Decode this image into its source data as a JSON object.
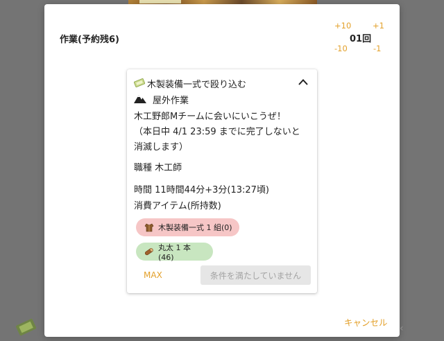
{
  "modal": {
    "title": "作業(予約残6)",
    "counter": {
      "plus10": "+10",
      "plus1": "+1",
      "count": "01回",
      "minus10": "-10",
      "minus1": "-1"
    },
    "cancel_label": "キャンセル"
  },
  "task": {
    "title": "木製装備一式で殴り込む",
    "location": "屋外作業",
    "description_line1": "木工野郎Mチームに会いにいこうぜ！",
    "description_line2": "（本日中 4/1 23:59 までに完了しないと",
    "description_line3": "消滅します）",
    "job": "職種 木工師",
    "time": "時間 11時間44分+3分(13:27頃)",
    "consume_label": "消費アイテム(所持数)",
    "items": [
      {
        "label": "木製装備一式 1 組(0)",
        "icon": "armor-icon",
        "status_color": "#f6c6c6"
      },
      {
        "label": "丸太 1 本(46)",
        "icon": "log-icon",
        "status_color": "#c8e6c0"
      }
    ],
    "max_label": "MAX",
    "submit_label": "条件を満たしていません"
  },
  "colors": {
    "accent": "#e3a02a",
    "overlay": "#747474"
  }
}
